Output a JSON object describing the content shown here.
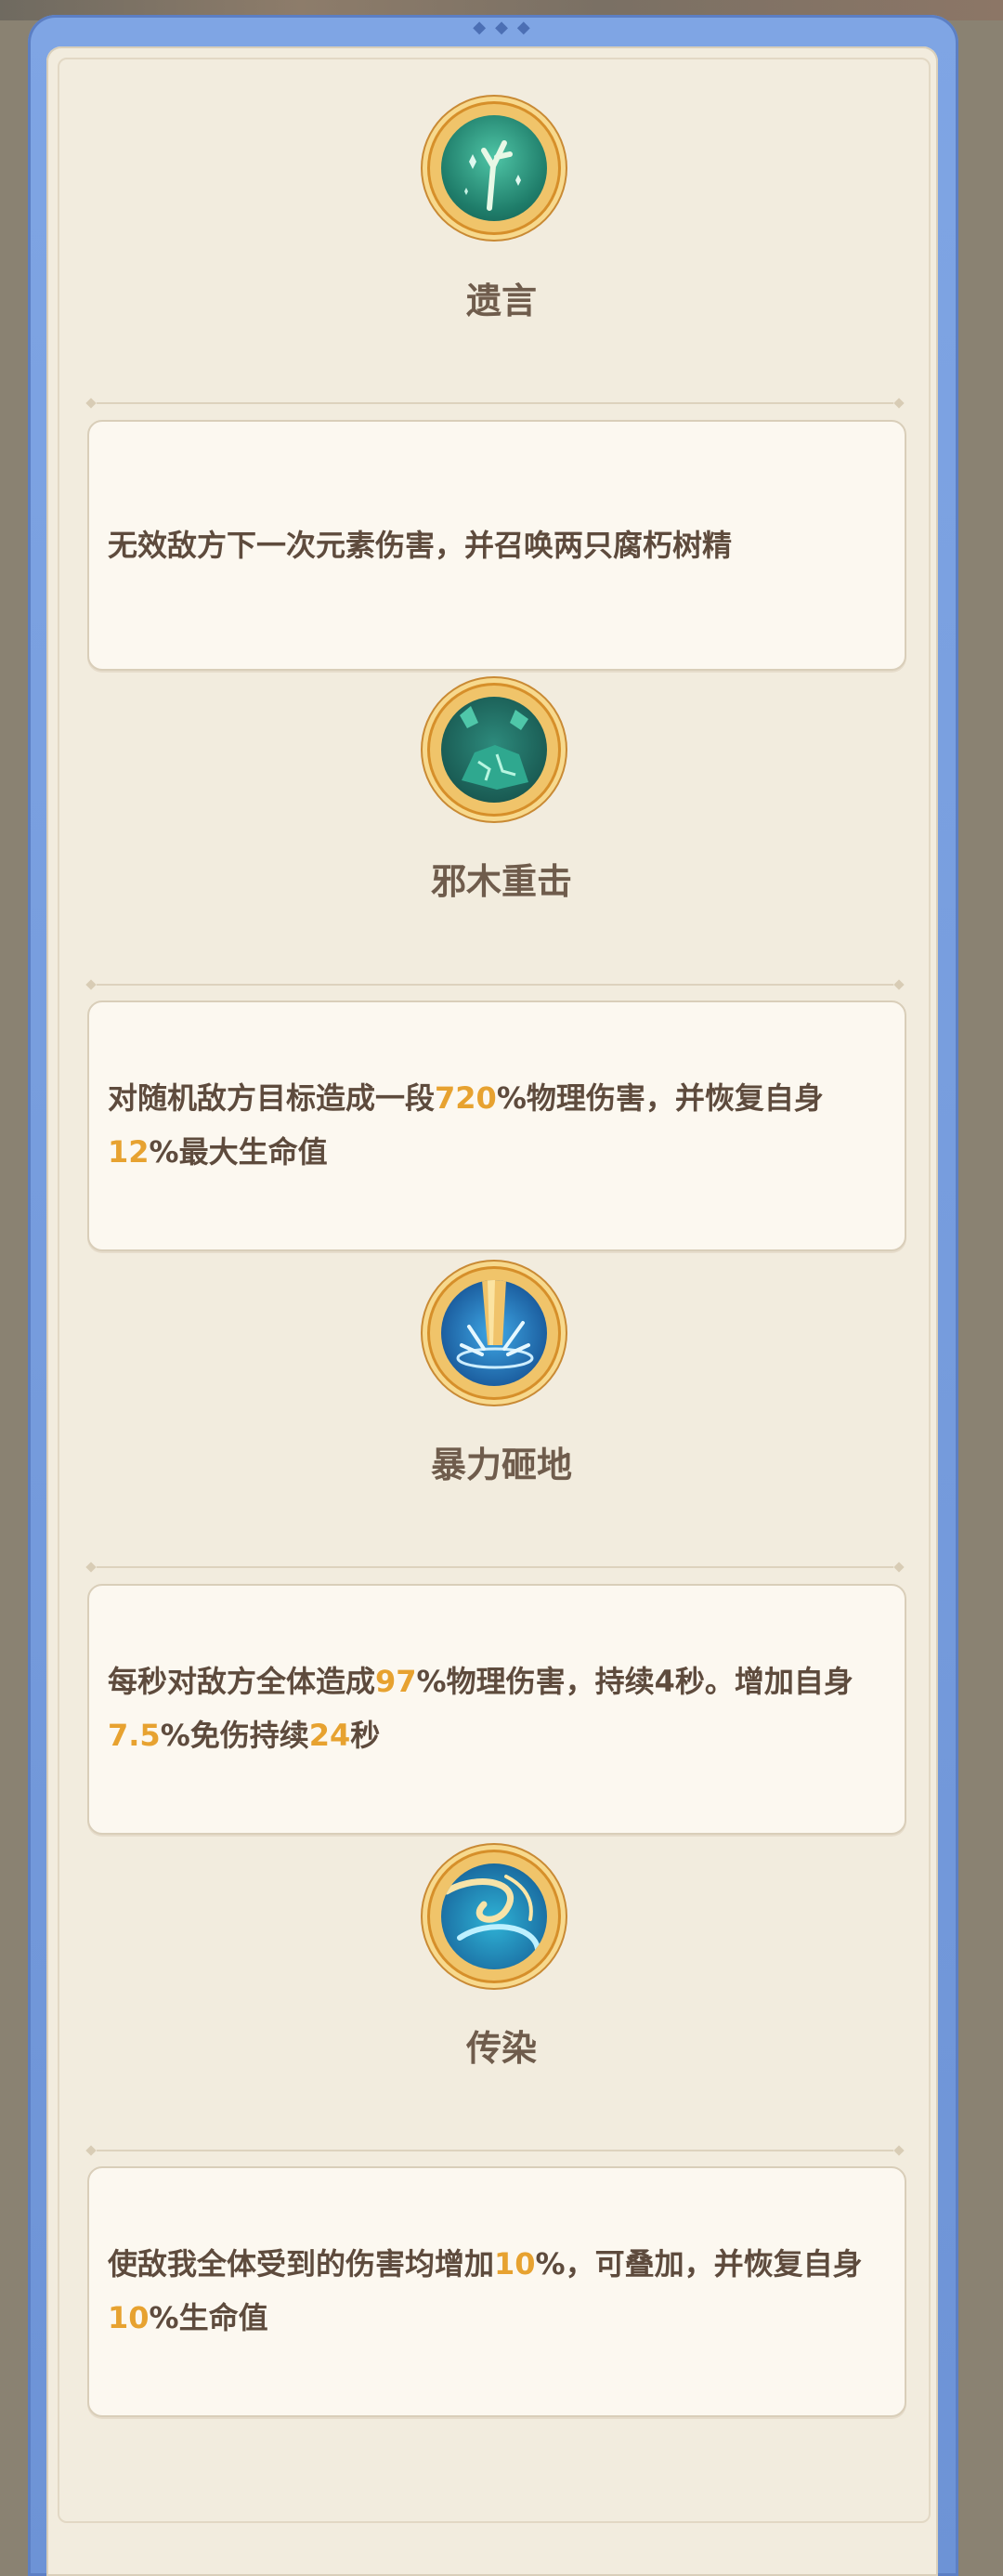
{
  "skills": [
    {
      "name": "遗言",
      "icon": "withered-tree-icon",
      "description": [
        {
          "t": "无效敌方下一次元素伤害，并召唤两只腐朽树精",
          "h": false
        }
      ]
    },
    {
      "name": "邪木重击",
      "icon": "cracked-rock-icon",
      "description": [
        {
          "t": "对随机敌方目标造成一段",
          "h": false
        },
        {
          "t": "720",
          "h": true
        },
        {
          "t": "%物理伤害，并恢复自身",
          "h": false
        },
        {
          "t": "12",
          "h": true
        },
        {
          "t": "%最大生命值",
          "h": false
        }
      ]
    },
    {
      "name": "暴力砸地",
      "icon": "ground-smash-icon",
      "description": [
        {
          "t": "每秒对敌方全体造成",
          "h": false
        },
        {
          "t": "97",
          "h": true
        },
        {
          "t": "%物理伤害，持续4秒。增加自身",
          "h": false
        },
        {
          "t": "7.5",
          "h": true
        },
        {
          "t": "%免伤持续",
          "h": false
        },
        {
          "t": "24",
          "h": true
        },
        {
          "t": "秒",
          "h": false
        }
      ]
    },
    {
      "name": "传染",
      "icon": "swirl-wave-icon",
      "description": [
        {
          "t": "使敌我全体受到的伤害均增加",
          "h": false
        },
        {
          "t": "10",
          "h": true
        },
        {
          "t": "%，可叠加，并恢复自身",
          "h": false
        },
        {
          "t": "10",
          "h": true
        },
        {
          "t": "%生命值",
          "h": false
        }
      ]
    }
  ],
  "colors": {
    "frame": "#7fa5e4",
    "panel": "#f2ecde",
    "highlight": "#e7a230",
    "text": "#5e4b3d"
  }
}
